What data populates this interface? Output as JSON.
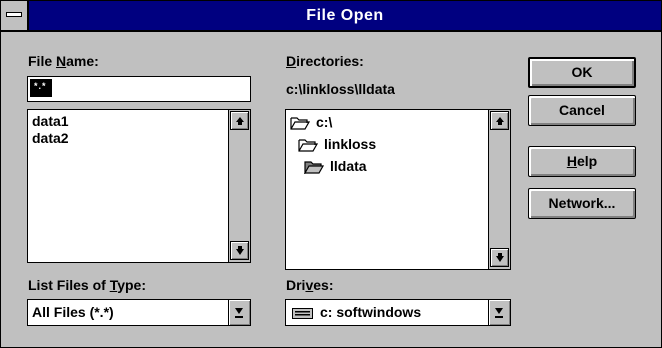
{
  "window": {
    "title": "File Open"
  },
  "file_name": {
    "label": "File Name:",
    "mnemonic": "N",
    "value": "",
    "files": [
      "data1",
      "data2"
    ]
  },
  "directories": {
    "label": "Directories:",
    "mnemonic": "D",
    "current_path": "c:\\linkloss\\lldata",
    "tree": [
      {
        "name": "c:\\",
        "state": "open"
      },
      {
        "name": "linkloss",
        "state": "open"
      },
      {
        "name": "lldata",
        "state": "open-current"
      }
    ]
  },
  "file_type": {
    "label": "List Files of Type:",
    "mnemonic": "T",
    "selected": "All Files (*.*)"
  },
  "drives": {
    "label": "Drives:",
    "mnemonic": "v",
    "selected": "c: softwindows",
    "icon": "drive-icon"
  },
  "buttons": {
    "ok": "OK",
    "cancel": "Cancel",
    "help": "Help",
    "help_mnemonic": "H",
    "network": "Network..."
  }
}
